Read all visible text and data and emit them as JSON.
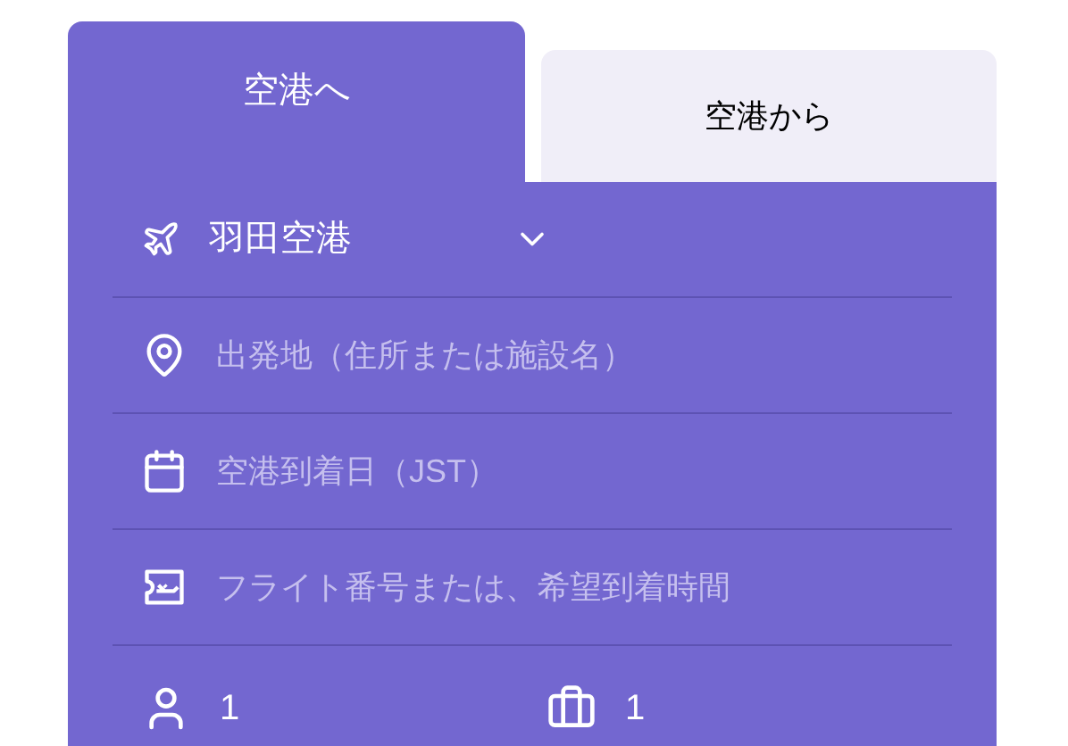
{
  "tabs": [
    {
      "label": "空港へ",
      "selected": true
    },
    {
      "label": "空港から",
      "selected": false
    }
  ],
  "fields": [
    {
      "kind": "airport",
      "value": "羽田空港"
    },
    {
      "kind": "origin",
      "placeholder": "出発地（住所または施設名）"
    },
    {
      "kind": "date",
      "placeholder": "空港到着日（JST）"
    },
    {
      "kind": "flight",
      "placeholder": "フライト番号または、希望到着時間"
    }
  ],
  "counts": [
    {
      "kind": "passengers",
      "value": "1"
    },
    {
      "kind": "luggage",
      "value": "1"
    }
  ]
}
